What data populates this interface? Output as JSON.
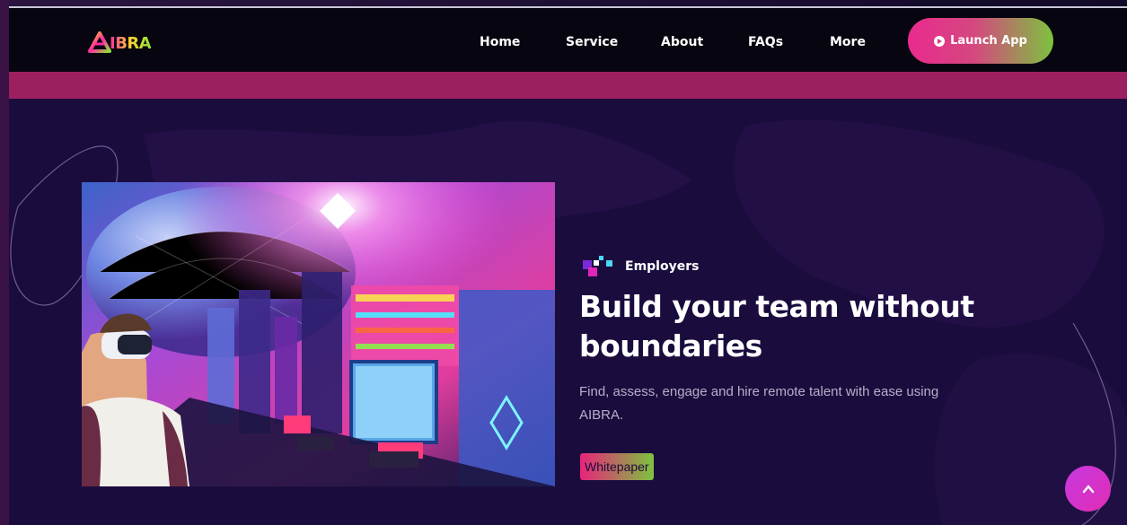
{
  "brand": {
    "name": "IBRA",
    "colors": {
      "pink": "#ea2a8e",
      "green": "#7dc23e",
      "navy": "#1b0c3e"
    }
  },
  "nav": {
    "items": [
      {
        "label": "Home"
      },
      {
        "label": "Service"
      },
      {
        "label": "About"
      },
      {
        "label": "FAQs"
      },
      {
        "label": "More"
      }
    ],
    "cta": {
      "label": "Launch App",
      "icon": "play-circle-icon"
    }
  },
  "hero": {
    "image_alt": "Neon cyberpunk city with VR headset",
    "eyebrow": {
      "label": "Employers",
      "icon": "pixel-squares-icon"
    },
    "headline": "Build your team without boundaries",
    "description": "Find, assess, engage and hire remote talent with ease using AIBRA.",
    "button": "Whitepaper"
  },
  "scroll_top": {
    "icon": "chevron-up-icon"
  }
}
